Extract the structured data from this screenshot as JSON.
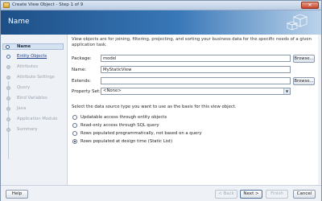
{
  "window": {
    "title": "Create View Object - Step 1 of 9",
    "close_glyph": "✕"
  },
  "header": {
    "title": "Name"
  },
  "nav": {
    "items": [
      {
        "label": "Name"
      },
      {
        "label": "Entity Objects"
      },
      {
        "label": "Attributes"
      },
      {
        "label": "Attribute Settings"
      },
      {
        "label": "Query"
      },
      {
        "label": "Bind Variables"
      },
      {
        "label": "Java"
      },
      {
        "label": "Application Module"
      },
      {
        "label": "Summary"
      }
    ]
  },
  "content": {
    "description": "View objects are for joining, filtering, projecting, and sorting your business data for the specific needs of a given application task.",
    "package": {
      "label": "Package:",
      "value": "model",
      "browse": "Browse..."
    },
    "name": {
      "label": "Name:",
      "value": "MyStaticView"
    },
    "extends": {
      "label": "Extends:",
      "value": "",
      "browse": "Browse..."
    },
    "property_set": {
      "label": "Property Set:",
      "value": "<None>"
    },
    "question": "Select the data source type you want to use as the basis for this view object.",
    "options": [
      {
        "label": "Updatable access through entity objects"
      },
      {
        "label": "Read-only access through SQL query"
      },
      {
        "label": "Rows populated programmatically, not based on a query"
      },
      {
        "label": "Rows populated at design time (Static List)"
      }
    ]
  },
  "footer": {
    "help": "Help",
    "back": "< Back",
    "next": "Next >",
    "finish": "Finish",
    "cancel": "Cancel"
  }
}
